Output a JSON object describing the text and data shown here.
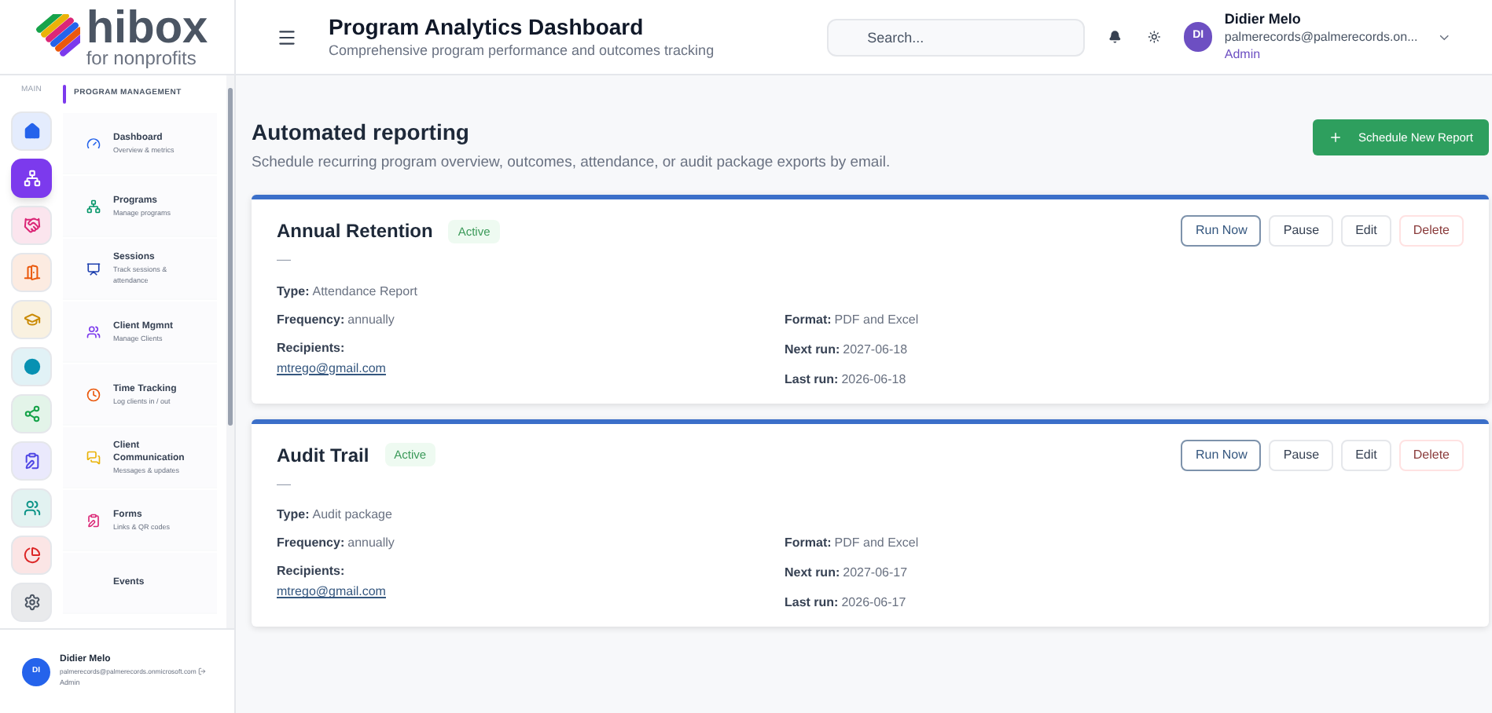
{
  "logo": {
    "name": "hibox",
    "tagline": "for nonprofits"
  },
  "rail": {
    "label": "MAIN",
    "items": [
      {
        "selected": false
      },
      {
        "selected": true
      },
      {
        "selected": false
      },
      {
        "selected": false
      },
      {
        "selected": false
      },
      {
        "selected": false
      },
      {
        "selected": false
      },
      {
        "selected": false
      },
      {
        "selected": false
      },
      {
        "selected": false
      },
      {
        "selected": false
      }
    ]
  },
  "sidebar": {
    "section": "PROGRAM MANAGEMENT",
    "items": [
      {
        "label": "Dashboard",
        "subtitle": "Overview & metrics"
      },
      {
        "label": "Programs",
        "subtitle": "Manage programs"
      },
      {
        "label": "Sessions",
        "subtitle": "Track sessions & attendance"
      },
      {
        "label": "Client Mgmnt",
        "subtitle": "Manage Clients"
      },
      {
        "label": "Time Tracking",
        "subtitle": "Log clients in / out"
      },
      {
        "label": "Client Communication",
        "subtitle": "Messages & updates"
      },
      {
        "label": "Forms",
        "subtitle": "Links & QR codes"
      },
      {
        "label": "Events"
      }
    ]
  },
  "user_footer": {
    "initials": "DI",
    "name": "Didier Melo",
    "email": "palmerecords@palmerecords.onmicrosoft.com",
    "role": "Admin"
  },
  "header": {
    "title": "Program Analytics Dashboard",
    "subtitle": "Comprehensive program performance and outcomes tracking",
    "search": {
      "placeholder": "Search..."
    },
    "user": {
      "initials": "DI",
      "name": "Didier Melo",
      "email": "palmerecords@palmerecords.on...",
      "role": "Admin"
    }
  },
  "page": {
    "title": "Automated reporting",
    "description": "Schedule recurring program overview, outcomes, attendance, or audit package exports by email.",
    "action": "Schedule New Report"
  },
  "reports": [
    {
      "name": "Annual Retention",
      "status": "Active",
      "description": "—",
      "type_label": "Type:",
      "type": "Attendance Report",
      "frequency_label": "Frequency:",
      "frequency": "annually",
      "recipients_label": "Recipients:",
      "recipients": "mtrego@gmail.com",
      "format_label": "Format:",
      "format": "PDF and Excel",
      "next_label": "Next run:",
      "next_run": "2027-06-18",
      "last_label": "Last run:",
      "last_run": "2026-06-18",
      "actions": [
        "Run Now",
        "Pause",
        "Edit",
        "Delete"
      ]
    },
    {
      "name": "Audit Trail",
      "status": "Active",
      "description": "—",
      "type_label": "Type:",
      "type": "Audit package",
      "frequency_label": "Frequency:",
      "frequency": "annually",
      "recipients_label": "Recipients:",
      "recipients": "mtrego@gmail.com",
      "format_label": "Format:",
      "format": "PDF and Excel",
      "next_label": "Next run:",
      "next_run": "2027-06-17",
      "last_label": "Last run:",
      "last_run": "2026-06-17",
      "actions": [
        "Run Now",
        "Pause",
        "Edit",
        "Delete"
      ]
    }
  ]
}
